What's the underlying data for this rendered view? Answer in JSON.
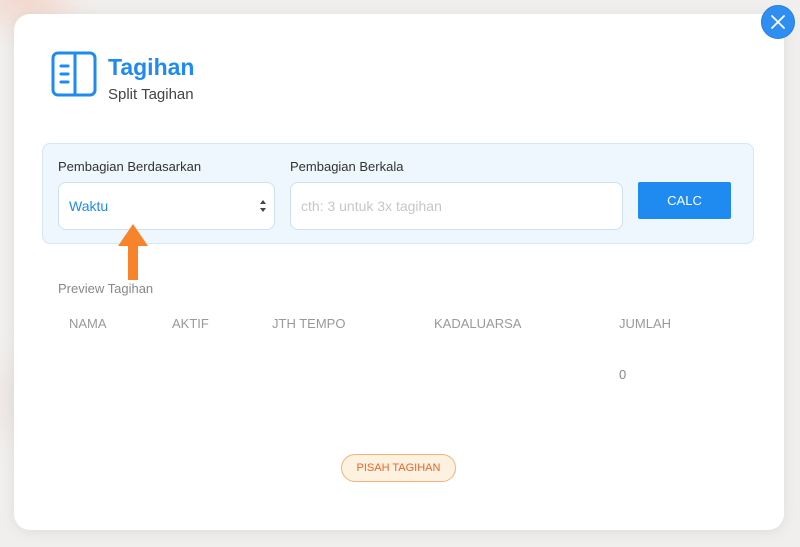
{
  "header": {
    "title": "Tagihan",
    "subtitle": "Split Tagihan"
  },
  "form": {
    "split_by_label": "Pembagian Berdasarkan",
    "split_by_value": "Waktu",
    "periodic_label": "Pembagian Berkala",
    "periodic_placeholder": "cth: 3 untuk 3x tagihan",
    "calc_label": "CALC"
  },
  "preview": {
    "label": "Preview Tagihan",
    "columns": [
      "NAMA",
      "AKTIF",
      "JTH TEMPO",
      "KADALUARSA",
      "JUMLAH"
    ],
    "total_value": "0"
  },
  "actions": {
    "split_label": "PISAH TAGIHAN"
  },
  "colors": {
    "accent": "#1f8af0",
    "highlight_arrow": "#f7842a",
    "split_button_text": "#e8672c"
  },
  "icons": {
    "header": "document-icon",
    "close": "close-icon",
    "annotation": "up-arrow-icon"
  }
}
